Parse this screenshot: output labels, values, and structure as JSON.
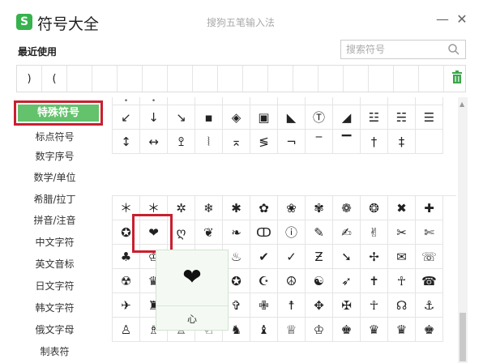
{
  "titlebar": {
    "logo_glyph": "S",
    "app_title": "符号大全",
    "center_title": "搜狗五笔输入法",
    "minimize_glyph": "—",
    "close_glyph": "✕"
  },
  "recent": {
    "label": "最近使用",
    "items": [
      ")",
      "(",
      "",
      "",
      "",
      "",
      "",
      "",
      "",
      "",
      "",
      "",
      "",
      "",
      "",
      "",
      ""
    ]
  },
  "search": {
    "placeholder": "搜索符号"
  },
  "sidebar": {
    "active": "特殊符号",
    "items": [
      "标点符号",
      "数字序号",
      "数学/单位",
      "希腊/拉丁",
      "拼音/注音",
      "中文字符",
      "英文音标",
      "日文字符",
      "韩文字符",
      "俄文字母",
      "制表符"
    ]
  },
  "grid": {
    "section1": [
      "•",
      "•",
      "",
      "",
      "",
      "",
      "",
      "",
      "",
      "",
      "",
      "",
      "",
      "↙",
      "↓",
      "↘",
      "▪",
      "◈",
      "▣",
      "◣",
      "Ⓣ",
      "◢",
      "☳",
      "☵",
      "☰",
      "",
      "↕",
      "↔",
      "ꖶ",
      "⦚",
      "⌅",
      "≶",
      "¬",
      "‾",
      "▔",
      "†",
      "‡",
      "",
      ""
    ],
    "section2": [
      "＊",
      "＊",
      "✲",
      "❄",
      "✱",
      "✿",
      "❀",
      "✾",
      "❁",
      "❂",
      "✖",
      "✚",
      "",
      "✪",
      "❤",
      "ღ",
      "❦",
      "❧",
      "ↀ",
      "ⓘ",
      "✎",
      "✍",
      "✌",
      "✂",
      "✄",
      "",
      "♣",
      "♔",
      "♧",
      "♤",
      "♨",
      "✔",
      "✓",
      "Ƶ",
      "➘",
      "✢",
      "✉",
      "☏",
      "",
      "☢",
      "♛",
      "♤",
      "♡",
      "✪",
      "☪",
      "☮",
      "☯",
      "➶",
      "✝",
      "☥",
      "☎",
      "",
      "✈",
      "♜",
      "♚",
      "♞",
      "✞",
      "✙",
      "☨",
      "✥",
      "✠",
      "☥",
      "☊",
      "⚓",
      "",
      "♙",
      "♗",
      "♖",
      "♘",
      "♞",
      "♝",
      "♕",
      "♔",
      "♚",
      "♛",
      "♛",
      "♚",
      ""
    ]
  },
  "preview": {
    "symbol": "❤",
    "name": "心"
  }
}
